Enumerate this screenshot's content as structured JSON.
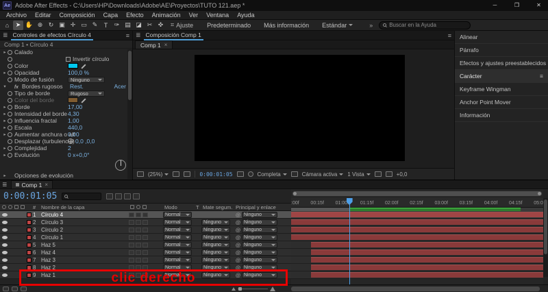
{
  "window": {
    "title": "Adobe After Effects - C:\\Users\\HP\\Downloads\\Adobe\\AE\\Proyectos\\TUTO 121.aep *",
    "logo": "Ae",
    "controls": {
      "minimize": "─",
      "maximize": "❐",
      "close": "✕"
    }
  },
  "menu": {
    "items": [
      "Archivo",
      "Editar",
      "Composición",
      "Capa",
      "Efecto",
      "Animación",
      "Ver",
      "Ventana",
      "Ayuda"
    ]
  },
  "toolbar": {
    "tools": [
      {
        "name": "home",
        "glyph": "⌂"
      },
      {
        "name": "selection",
        "glyph": "➤",
        "cls": "active"
      },
      {
        "name": "hand",
        "glyph": "✋"
      },
      {
        "name": "zoom",
        "glyph": "⊕"
      },
      {
        "name": "orbit",
        "glyph": "↻"
      },
      {
        "name": "camera",
        "glyph": "▣"
      },
      {
        "name": "pan-behind",
        "glyph": "✛"
      },
      {
        "name": "shape",
        "glyph": "▭"
      },
      {
        "name": "pen",
        "glyph": "✎"
      },
      {
        "name": "type",
        "glyph": "T"
      },
      {
        "name": "brush",
        "glyph": "✑"
      },
      {
        "name": "clone-stamp",
        "glyph": "▤"
      },
      {
        "name": "eraser",
        "glyph": "◪"
      },
      {
        "name": "roto-brush",
        "glyph": "✂"
      },
      {
        "name": "puppet",
        "glyph": "✜"
      }
    ],
    "snap_glyph": "⌗",
    "snap_label": "Ajuste",
    "workspace": [
      "Predeterminado",
      "Más información",
      "Estándar"
    ],
    "overflow": "»",
    "search_placeholder": "Buscar en la Ayuda"
  },
  "effects_panel": {
    "hamburger": "≣",
    "tab": "Controles de efectos Círculo 4",
    "panel_menu": "≡",
    "breadcrumb": "Comp 1 • Círculo 4",
    "rows": [
      {
        "twirl": "▸",
        "stopwatch": true,
        "label": "Calado"
      },
      {
        "stopwatch": true,
        "checkbox": true,
        "cb_label": "Invertir círculo"
      },
      {
        "stopwatch": true,
        "label": "Color",
        "swatch": "#00c8f0",
        "eyedropper": true
      },
      {
        "twirl": "▸",
        "stopwatch": true,
        "label": "Opacidad",
        "value": "100,0 %"
      },
      {
        "stopwatch": true,
        "label": "Modo de fusión",
        "dropdown": "Ninguno"
      },
      {
        "twirl": "▾",
        "fx": true,
        "label": "Bordes rugosos",
        "link1": "Rest.",
        "link2": "Acer"
      },
      {
        "stopwatch": true,
        "label": "Tipo de borde",
        "dropdown": "Rugoso"
      },
      {
        "stopwatch": true,
        "label": "Color del borde",
        "swatch": "#f0a040",
        "eyedropper": true,
        "cls": "dim"
      },
      {
        "twirl": "▸",
        "stopwatch": true,
        "label": "Borde",
        "value": "17,00"
      },
      {
        "twirl": "▸",
        "stopwatch": true,
        "label": "Intensidad del borde",
        "value": "4,30"
      },
      {
        "twirl": "▸",
        "stopwatch": true,
        "label": "Influencia fractal",
        "value": "1,00"
      },
      {
        "twirl": "▸",
        "stopwatch": true,
        "label": "Escala",
        "value": "440,0"
      },
      {
        "twirl": "▸",
        "stopwatch": true,
        "label": "Aumentar anchura o alt",
        "value": "0,00"
      },
      {
        "stopwatch": true,
        "label": "Desplazar (turbulencia)",
        "crosshair": true,
        "value": "0,0 ,0,0"
      },
      {
        "twirl": "▸",
        "stopwatch": true,
        "label": "Complejidad",
        "value": "2"
      },
      {
        "twirl": "▸",
        "stopwatch": true,
        "label": "Evolución",
        "value": "0 x+0,0°"
      },
      {
        "dial": true,
        "cls": "dial-row"
      },
      {
        "twirl": "▸",
        "label": "Opciones de evolución"
      }
    ]
  },
  "comp_panel": {
    "hamburger": "≣",
    "title": "Composición Comp 1",
    "tab": "Comp 1",
    "tab_close": "×",
    "statusbar": {
      "zoom": "(25%)",
      "timecode": "0:00:01:05",
      "resolution": "Completa",
      "camera": "Cámara activa",
      "view": "1 Vista",
      "exposure": "+0,0"
    }
  },
  "right_panels": {
    "items": [
      {
        "label": "Alinear"
      },
      {
        "label": "Párrafo"
      },
      {
        "label": "Efectos y ajustes preestablecidos"
      },
      {
        "label": "Carácter",
        "cls": "active",
        "menu": "≡"
      },
      {
        "label": "Keyframe Wingman"
      },
      {
        "label": "Anchor Point Mover"
      },
      {
        "label": "Información"
      }
    ]
  },
  "timeline": {
    "hamburger": "≣",
    "tab": "Comp 1",
    "tab_close": "×",
    "timecode": "0:00:01:05",
    "parent_at": "@",
    "columns": {
      "num": "#",
      "name": "Nombre de la capa",
      "mode": "Modo",
      "t": "T",
      "matte": "Mate segum.",
      "parent": "Principal y enlace"
    },
    "layers": [
      {
        "num": 1,
        "name": "Círculo 4",
        "mode": "Normal",
        "parent": "Ninguno",
        "cls": "selected bar-a"
      },
      {
        "num": 2,
        "name": "Círculo 3",
        "mode": "Normal",
        "matte": "Ninguno",
        "parent": "Ninguno",
        "cls": "bar-a"
      },
      {
        "num": 3,
        "name": "Círculo 2",
        "mode": "Normal",
        "matte": "Ninguno",
        "parent": "Ninguno",
        "cls": "bar-a"
      },
      {
        "num": 4,
        "name": "Círculo 1",
        "mode": "Normal",
        "matte": "Ninguno",
        "parent": "Ninguno",
        "cls": "bar-a"
      },
      {
        "num": 5,
        "name": "Haz 5",
        "mode": "Normal",
        "matte": "Ninguno",
        "parent": "Ninguno",
        "cls": "bar-b"
      },
      {
        "num": 6,
        "name": "Haz 4",
        "mode": "Normal",
        "matte": "Ninguno",
        "parent": "Ninguno",
        "cls": "bar-b"
      },
      {
        "num": 7,
        "name": "Haz 3",
        "mode": "Normal",
        "matte": "Ninguno",
        "parent": "Ninguno",
        "cls": "bar-b"
      },
      {
        "num": 8,
        "name": "Haz 2",
        "mode": "Normal",
        "matte": "Ninguno",
        "parent": "Ninguno",
        "cls": "bar-b"
      },
      {
        "num": 9,
        "name": "Haz 1",
        "mode": "Normal",
        "matte": "Ninguno",
        "parent": "Ninguno",
        "cls": "bar-b"
      }
    ],
    "ruler": [
      ":00f",
      "00:15f",
      "01:00f",
      "01:15f",
      "02:00f",
      "02:15f",
      "03:00f",
      "03:15f",
      "04:00f",
      "04:15f",
      "05:0"
    ],
    "annotation": "clic derecho"
  },
  "colors": {
    "accent_blue": "#4f9fd8",
    "value_blue": "#7bb1e0",
    "timecode_blue": "#6aa5e0",
    "layer_red": "#8a3a3a",
    "workarea_green": "#4ad34a",
    "annotation_red": "#e80000"
  }
}
